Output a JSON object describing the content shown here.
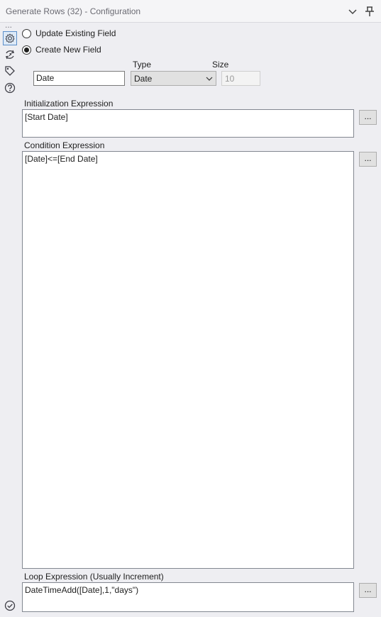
{
  "window": {
    "title": "Generate Rows (32) - Configuration"
  },
  "sidebar": {
    "more_label": "...",
    "icons": [
      "gear-icon",
      "refresh-icon",
      "tag-icon",
      "help-icon",
      "check-circle-icon"
    ]
  },
  "options": {
    "update_existing_label": "Update Existing Field",
    "update_existing_checked": false,
    "create_new_label": "Create New  Field",
    "create_new_checked": true
  },
  "field": {
    "name_value": "Date",
    "type_label": "Type",
    "type_value": "Date",
    "size_label": "Size",
    "size_value": "10"
  },
  "expressions": {
    "init_label": "Initialization Expression",
    "init_value": "[Start Date]",
    "cond_label": "Condition Expression",
    "cond_value": "[Date]<=[End Date]",
    "loop_label": "Loop Expression (Usually Increment)",
    "loop_value": "DateTimeAdd([Date],1,\"days\")",
    "edit_button_label": "..."
  },
  "colors": {
    "panel_bg": "#eeeef2",
    "active_icon_border": "#5b8ec9",
    "icon_color": "#3d3d45"
  }
}
